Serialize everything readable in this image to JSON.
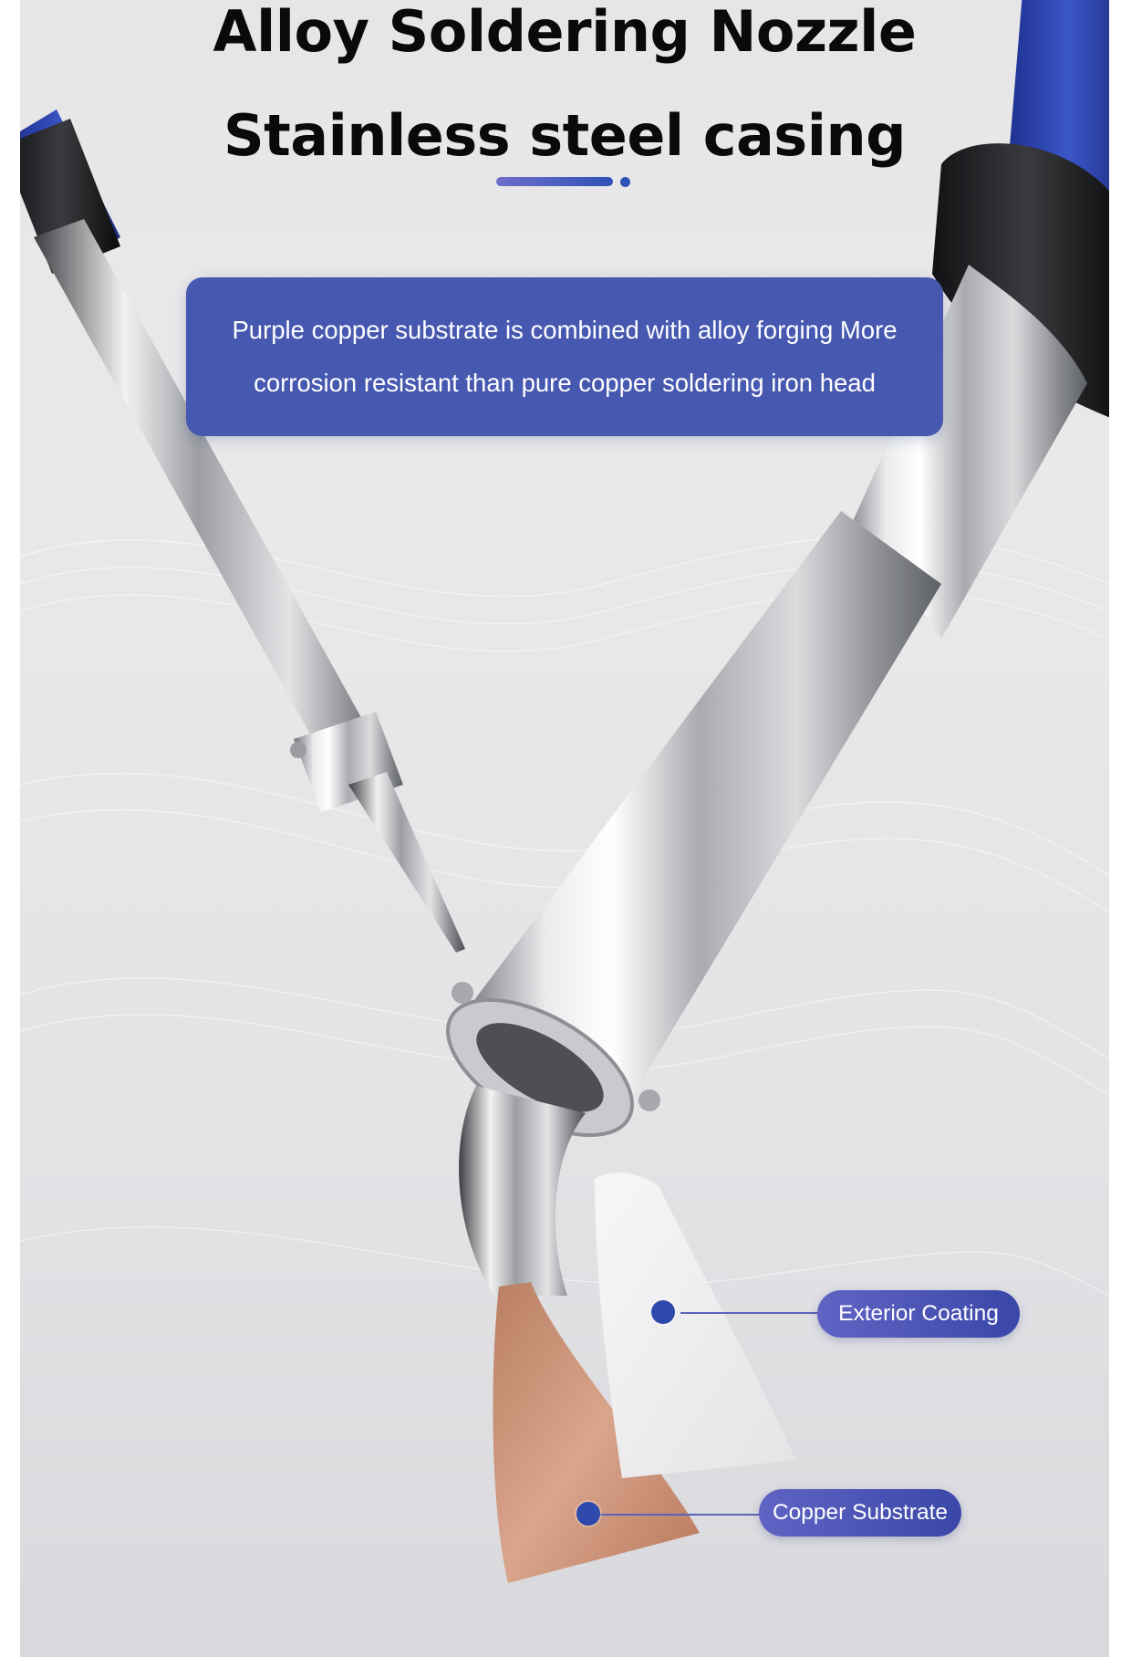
{
  "headline": {
    "line1": "Alloy Soldering Nozzle",
    "line2": "Stainless steel casing"
  },
  "description": "Purple copper substrate is combined with alloy forging More corrosion resistant than pure copper soldering iron head",
  "callouts": {
    "exterior": "Exterior Coating",
    "copper": "Copper Substrate"
  },
  "colors": {
    "accent_blue": "#4658b0",
    "handle_blue": "#2f44b0",
    "copper": "#c98a6c",
    "steel": "#c8c9cc"
  }
}
